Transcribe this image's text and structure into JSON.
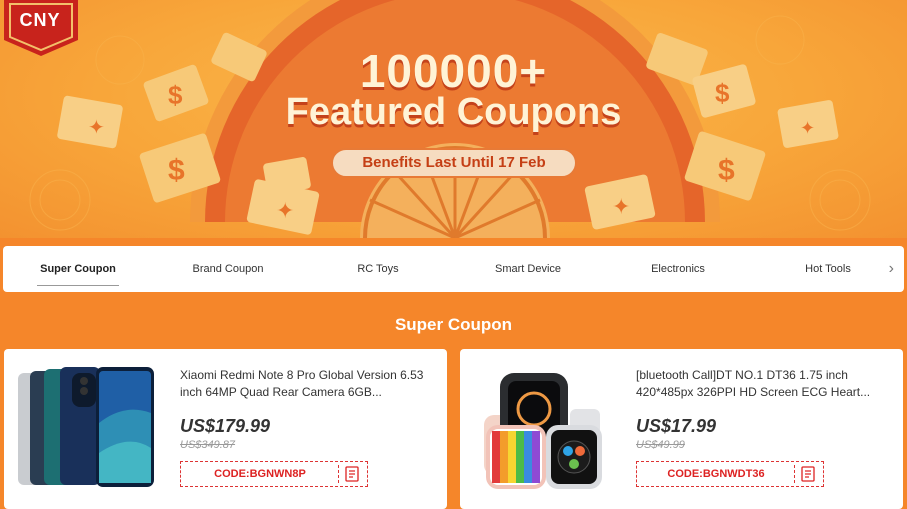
{
  "banner": {
    "badge": "CNY",
    "title_line1": "100000+",
    "title_line2": "Featured Coupons",
    "subtitle": "Benefits Last Until 17 Feb"
  },
  "tabs": [
    {
      "label": "Super Coupon",
      "active": true
    },
    {
      "label": "Brand Coupon"
    },
    {
      "label": "RC Toys"
    },
    {
      "label": "Smart Device"
    },
    {
      "label": "Electronics"
    },
    {
      "label": "Hot Tools"
    }
  ],
  "tabs_more_icon": "chevron-right-icon",
  "section_title": "Super Coupon",
  "products": [
    {
      "name": "Xiaomi Redmi Note 8 Pro Global Version 6.53 inch 64MP Quad Rear Camera 6GB...",
      "price": "US$179.99",
      "old_price": "US$349.87",
      "code": "CODE:BGNWN8P",
      "image": "smartphone"
    },
    {
      "name": "[bluetooth Call]DT NO.1 DT36 1.75 inch 420*485px 326PPI HD Screen ECG Heart...",
      "price": "US$17.99",
      "old_price": "US$49.99",
      "code": "CODE:BGNWDT36",
      "image": "smartwatch"
    }
  ],
  "colors": {
    "accent": "#f5862a",
    "code_red": "#dd2222",
    "pill_text": "#c53f15"
  }
}
